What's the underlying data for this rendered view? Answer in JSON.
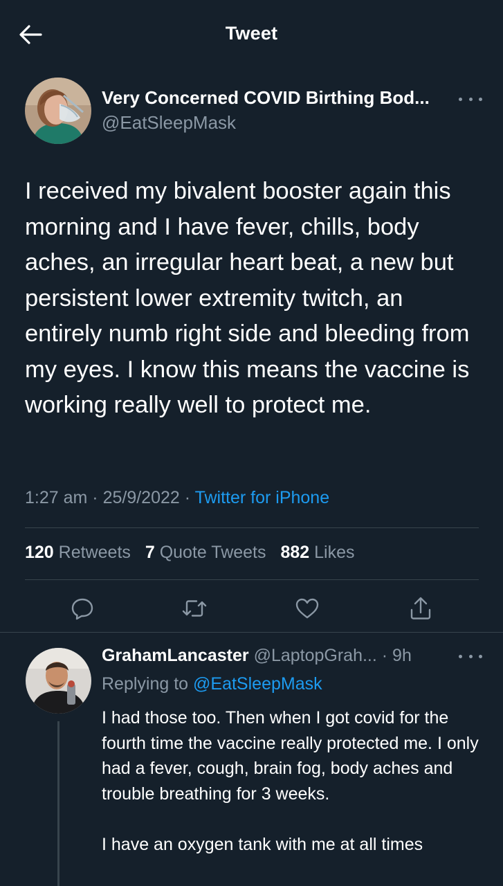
{
  "header": {
    "title": "Tweet",
    "back_icon": "arrow-left-icon"
  },
  "tweet": {
    "author_name": "Very Concerned COVID Birthing Bod...",
    "author_handle": "@EatSleepMask",
    "text": "I received my bivalent booster again this morning and I have fever, chills, body aches, an irregular heart beat, a new but persistent lower extremity twitch, an entirely numb right side and bleeding from my eyes. I know this means the vaccine is working really well to protect me.",
    "time": "1:27 am",
    "date": "25/9/2022",
    "separator": "·",
    "source": "Twitter for iPhone",
    "stats": {
      "retweets_count": "120",
      "retweets_label": "Retweets",
      "quotes_count": "7",
      "quotes_label": "Quote Tweets",
      "likes_count": "882",
      "likes_label": "Likes"
    },
    "actions": [
      "reply-icon",
      "retweet-icon",
      "like-icon",
      "share-icon"
    ]
  },
  "reply": {
    "author_name": "GrahamLancaster",
    "author_handle": "@LaptopGrah...",
    "time_meta": "· 9h",
    "replying_label": "Replying to",
    "replying_to": "@EatSleepMask",
    "paragraphs": [
      "I had those too. Then when I got covid for the fourth time the vaccine really protected me. I only had a fever, cough, brain fog, body aches and trouble breathing for 3 weeks.",
      "I have an oxygen tank with me at all times"
    ]
  },
  "colors": {
    "background": "#15202b",
    "text": "#ffffff",
    "muted": "#8b98a5",
    "accent": "#1d9bf0",
    "divider": "#38444d"
  }
}
